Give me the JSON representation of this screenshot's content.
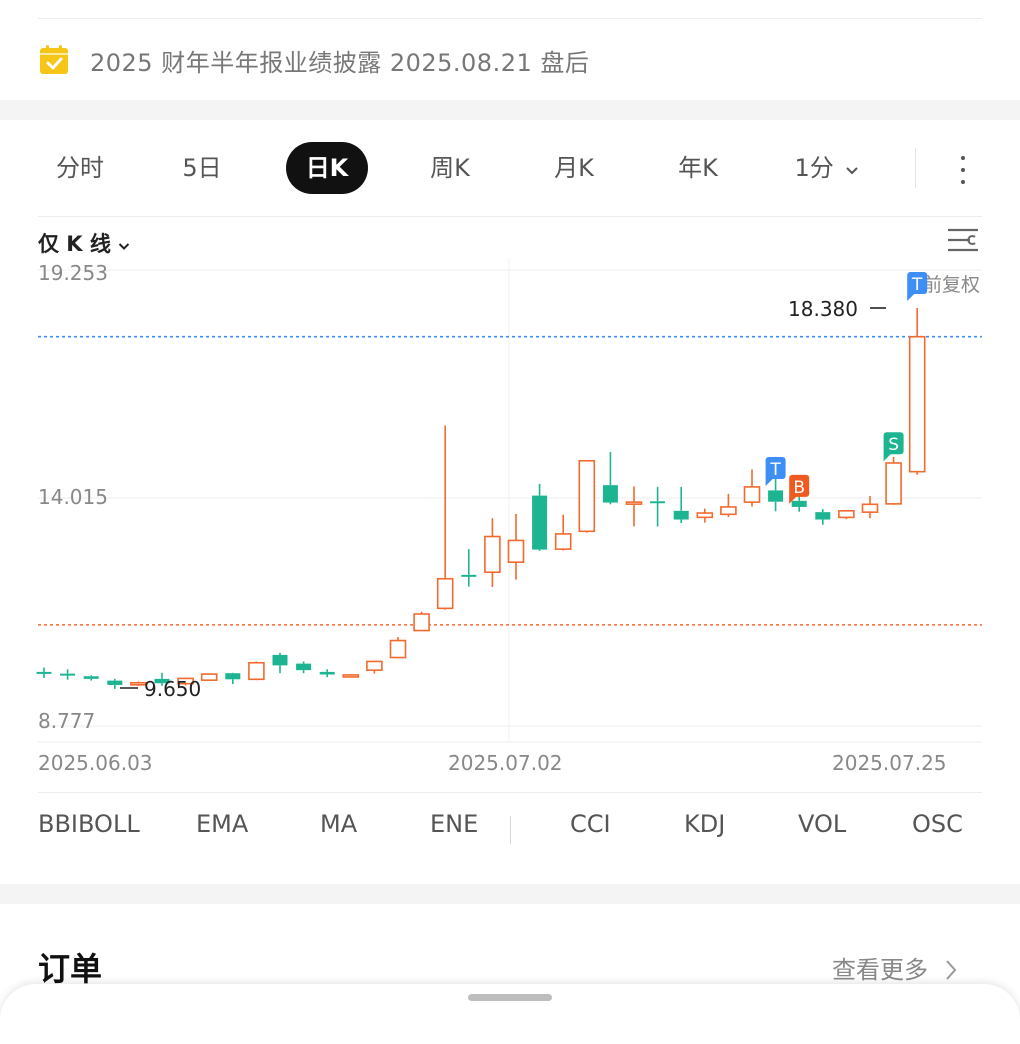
{
  "notice": {
    "text": "2025 财年半年报业绩披露 2025.08.21 盘后",
    "icon": "calendar-check-icon",
    "icon_color": "#F5C518"
  },
  "tabs": [
    {
      "label": "分时",
      "active": false
    },
    {
      "label": "5日",
      "active": false
    },
    {
      "label": "日K",
      "active": true
    },
    {
      "label": "周K",
      "active": false
    },
    {
      "label": "月K",
      "active": false
    },
    {
      "label": "年K",
      "active": false
    },
    {
      "label": "1分",
      "active": false
    }
  ],
  "chart_mode": "仅 K 线",
  "adjust_label": "前复权",
  "colors": {
    "up": "#F26A2E",
    "down": "#1DB591",
    "blue_marker": "#3D8FF5",
    "buy_marker": "#F05A1E",
    "sell_marker": "#1DB591"
  },
  "chart_data": {
    "type": "candlestick",
    "y_ticks": [
      "19.253",
      "14.015",
      "8.777"
    ],
    "ylim": [
      8.777,
      19.253
    ],
    "x_labels": [
      "2025.06.03",
      "2025.07.02",
      "2025.07.25"
    ],
    "max_label": "18.380",
    "min_label": "9.650",
    "reference_lines": [
      {
        "value": 17.72,
        "color": "#3D8FF5",
        "style": "dotted"
      },
      {
        "value": 11.1,
        "color": "#F26A2E",
        "style": "dotted"
      }
    ],
    "candles": [
      {
        "o": 10.02,
        "c": 9.98,
        "h": 10.12,
        "l": 9.88
      },
      {
        "o": 9.98,
        "c": 9.97,
        "h": 10.08,
        "l": 9.84
      },
      {
        "o": 9.92,
        "c": 9.86,
        "h": 9.94,
        "l": 9.82
      },
      {
        "o": 9.82,
        "c": 9.72,
        "h": 9.86,
        "l": 9.63
      },
      {
        "o": 9.73,
        "c": 9.77,
        "h": 9.8,
        "l": 9.7
      },
      {
        "o": 9.86,
        "c": 9.76,
        "h": 10.0,
        "l": 9.7
      },
      {
        "o": 9.75,
        "c": 9.87,
        "h": 9.89,
        "l": 9.71
      },
      {
        "o": 9.83,
        "c": 9.97,
        "h": 9.98,
        "l": 9.82
      },
      {
        "o": 9.99,
        "c": 9.85,
        "h": 10.0,
        "l": 9.74
      },
      {
        "o": 9.85,
        "c": 10.23,
        "h": 10.26,
        "l": 9.83
      },
      {
        "o": 10.41,
        "c": 10.17,
        "h": 10.46,
        "l": 9.99
      },
      {
        "o": 10.21,
        "c": 10.06,
        "h": 10.26,
        "l": 9.99
      },
      {
        "o": 10.02,
        "c": 9.96,
        "h": 10.08,
        "l": 9.9
      },
      {
        "o": 9.94,
        "c": 9.95,
        "h": 9.97,
        "l": 9.91
      },
      {
        "o": 10.06,
        "c": 10.26,
        "h": 10.26,
        "l": 9.98
      },
      {
        "o": 10.35,
        "c": 10.74,
        "h": 10.82,
        "l": 10.34
      },
      {
        "o": 10.97,
        "c": 11.35,
        "h": 11.4,
        "l": 10.96
      },
      {
        "o": 11.48,
        "c": 12.16,
        "h": 15.68,
        "l": 11.45
      },
      {
        "o": 12.25,
        "c": 12.23,
        "h": 12.84,
        "l": 11.98
      },
      {
        "o": 12.31,
        "c": 13.13,
        "h": 13.55,
        "l": 11.97
      },
      {
        "o": 12.54,
        "c": 13.04,
        "h": 13.65,
        "l": 12.14
      },
      {
        "o": 14.07,
        "c": 12.83,
        "h": 14.34,
        "l": 12.8
      },
      {
        "o": 12.84,
        "c": 13.19,
        "h": 13.63,
        "l": 12.81
      },
      {
        "o": 13.25,
        "c": 14.87,
        "h": 14.89,
        "l": 13.22
      },
      {
        "o": 14.31,
        "c": 13.91,
        "h": 15.07,
        "l": 13.87
      },
      {
        "o": 13.91,
        "c": 13.92,
        "h": 14.28,
        "l": 13.36
      },
      {
        "o": 13.94,
        "c": 13.93,
        "h": 14.27,
        "l": 13.36
      },
      {
        "o": 13.72,
        "c": 13.52,
        "h": 14.27,
        "l": 13.44
      },
      {
        "o": 13.57,
        "c": 13.67,
        "h": 13.77,
        "l": 13.45
      },
      {
        "o": 13.64,
        "c": 13.81,
        "h": 14.11,
        "l": 13.58
      },
      {
        "o": 13.92,
        "c": 14.27,
        "h": 14.67,
        "l": 13.82
      },
      {
        "o": 14.19,
        "c": 13.93,
        "h": 14.96,
        "l": 13.71
      },
      {
        "o": 13.95,
        "c": 13.81,
        "h": 14.06,
        "l": 13.7
      },
      {
        "o": 13.69,
        "c": 13.52,
        "h": 13.76,
        "l": 13.4
      },
      {
        "o": 13.57,
        "c": 13.72,
        "h": 13.73,
        "l": 13.53
      },
      {
        "o": 13.69,
        "c": 13.87,
        "h": 14.06,
        "l": 13.55
      },
      {
        "o": 13.88,
        "c": 14.82,
        "h": 14.96,
        "l": 13.86
      },
      {
        "o": 14.62,
        "c": 17.72,
        "h": 18.38,
        "l": 14.55
      }
    ],
    "markers": [
      {
        "label": "T",
        "candle": 37,
        "price": 18.93,
        "color": "blue"
      },
      {
        "label": "T",
        "candle": 31,
        "price": 14.68,
        "color": "blue"
      },
      {
        "label": "B",
        "candle": 32,
        "price": 14.27,
        "color": "buy"
      },
      {
        "label": "S",
        "candle": 36,
        "price": 15.25,
        "color": "sell"
      }
    ]
  },
  "indicators": [
    "BBIBOLL",
    "EMA",
    "MA",
    "ENE",
    "CCI",
    "KDJ",
    "VOL",
    "OSC"
  ],
  "orders": {
    "title": "订单",
    "view_more": "查看更多"
  }
}
